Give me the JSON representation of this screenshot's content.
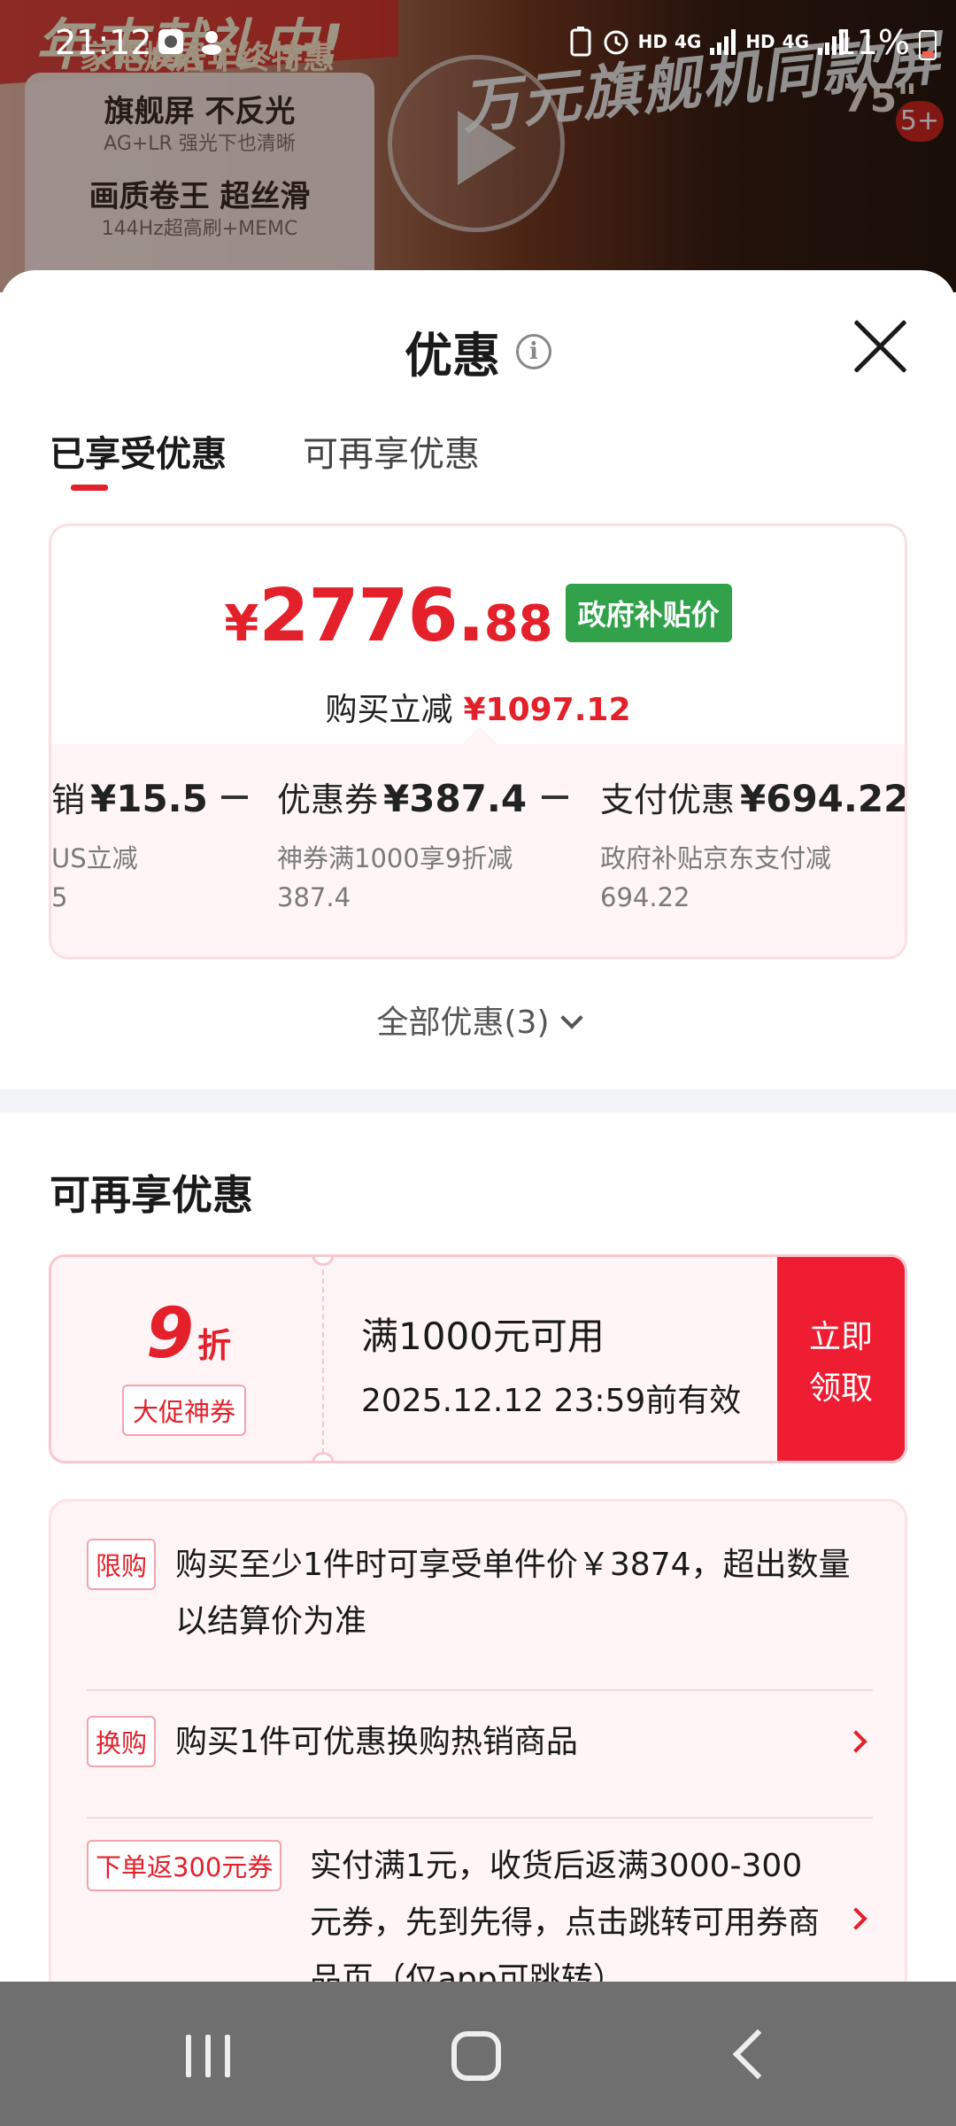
{
  "status_bar": {
    "time": "21:12",
    "network_label_1": "HD",
    "network_type_1": "4G",
    "network_label_2": "HD",
    "network_type_2": "4G",
    "battery": "11%"
  },
  "background": {
    "ribbon_text": "年末献礼中!",
    "ribbon_sub": "家电焕居年终特惠",
    "feature_1_title": "旗舰屏 不反光",
    "feature_1_sub": "AG+LR 强光下也清晰",
    "feature_2_title": "画质卷王 超丝滑",
    "feature_2_sub": "144Hz超高刷+MEMC",
    "slogan": "万元旗舰机同款屏",
    "size": "75\"",
    "badge": "5+"
  },
  "sheet": {
    "title": "优惠",
    "info_glyph": "i",
    "tabs": [
      {
        "label": "已享受优惠",
        "active": true
      },
      {
        "label": "可再享优惠",
        "active": false
      }
    ]
  },
  "price_card": {
    "currency": "¥",
    "price_int": "2776.",
    "price_dec": "88",
    "gov_tag": "政府补贴价",
    "saving_label": "购买立减",
    "saving_value": "¥1097.12",
    "breakdown": [
      {
        "title": "销",
        "amount": "¥15.5",
        "desc_1": "US立减",
        "desc_2": "5"
      },
      {
        "title": "优惠券",
        "amount": "¥387.4",
        "desc_1": "神券满1000享9折减",
        "desc_2": "387.4"
      },
      {
        "title": "支付优惠",
        "amount": "¥694.22",
        "desc_1": "政府补贴京东支付减",
        "desc_2": "694.22"
      }
    ]
  },
  "all_offers": "全部优惠(3)",
  "more_section": {
    "title": "可再享优惠",
    "coupon": {
      "discount": "9",
      "unit": "折",
      "tag": "大促神券",
      "condition": "满1000元可用",
      "validity": "2025.12.12 23:59前有效",
      "claim_line_1": "立即",
      "claim_line_2": "领取"
    },
    "promos": [
      {
        "tag": "限购",
        "text": "购买至少1件时可享受单件价￥3874，超出数量以结算价为准"
      },
      {
        "tag": "换购",
        "text": "购买1件可优惠换购热销商品"
      },
      {
        "tag": "下单返300元券",
        "text": "实付满1元，收货后返满3000-300元券，先到先得，点击跳转可用券商品页（仅app可跳转）"
      }
    ]
  },
  "colors": {
    "accent_red": "#e4202a",
    "gov_green": "#31a24a",
    "claim_red": "#ef1d32"
  }
}
